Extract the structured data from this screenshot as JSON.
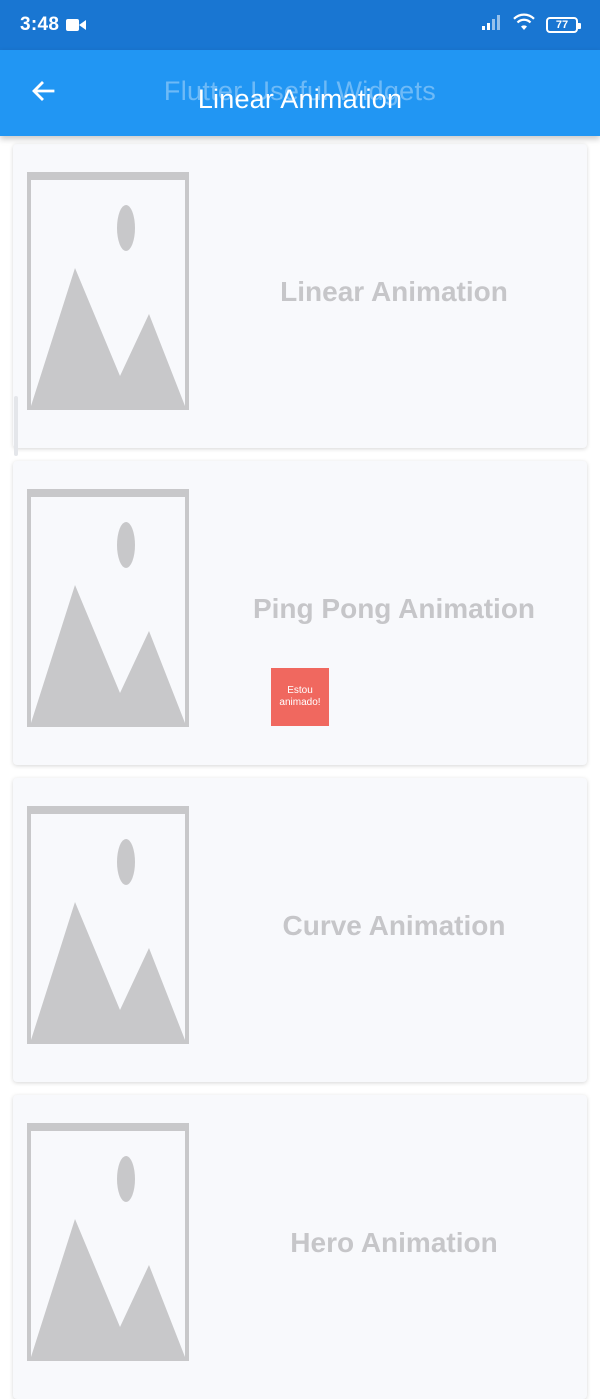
{
  "status_bar": {
    "time": "3:48",
    "battery": "77",
    "icons": [
      "video-icon",
      "signal-icon",
      "wifi-icon",
      "battery-icon"
    ]
  },
  "app_bar": {
    "back_icon": "arrow-left-icon",
    "ghost_title": "Flutter Useful Widgets",
    "title": "Linear Animation"
  },
  "cards": [
    {
      "label": "Linear Animation",
      "image_icon": "image-placeholder-icon"
    },
    {
      "label": "Ping Pong Animation",
      "image_icon": "image-placeholder-icon"
    },
    {
      "label": "Curve Animation",
      "image_icon": "image-placeholder-icon"
    },
    {
      "label": "Hero Animation",
      "image_icon": "image-placeholder-icon"
    }
  ],
  "animated_box": {
    "text": "Estou animado!",
    "color": "#F0685F"
  },
  "colors": {
    "status_bar": "#1976D2",
    "app_bar": "#2196F3",
    "card_background": "#F8F9FC",
    "card_text": "#C6C6C9",
    "placeholder": "#C8C8CA"
  }
}
